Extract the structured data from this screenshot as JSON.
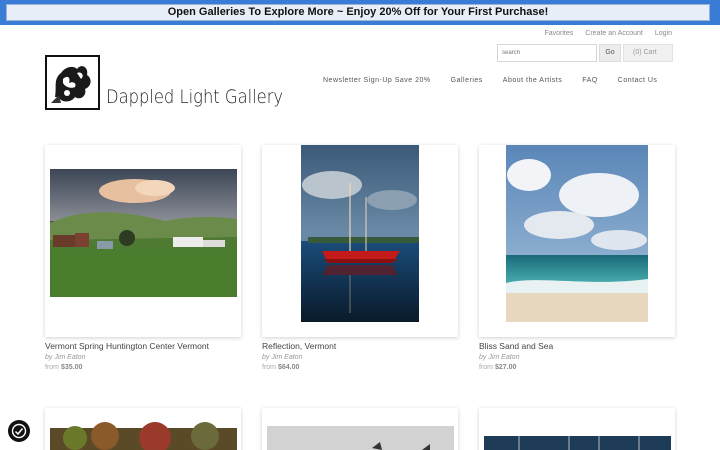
{
  "promo": {
    "text": "Open Galleries To Explore More ~ Enjoy 20% Off for Your First Purchase!"
  },
  "toplinks": {
    "favorites": "Favorites",
    "create_account": "Create an Account",
    "login": "Login"
  },
  "search": {
    "placeholder": "search",
    "go_label": "Go",
    "cart_label": "(0)  Cart"
  },
  "brand": {
    "name": "Dappled Light Gallery"
  },
  "nav": [
    {
      "label": "Newsletter Sign-Up Save 20%"
    },
    {
      "label": "Galleries"
    },
    {
      "label": "About the Artists"
    },
    {
      "label": "FAQ"
    },
    {
      "label": "Contact Us"
    }
  ],
  "products": [
    {
      "title": "Vermont Spring Huntington Center Vermont",
      "artist": "by Jim Eaton",
      "from": "from",
      "price": "$35.00"
    },
    {
      "title": "Reflection, Vermont",
      "artist": "by Jim Eaton",
      "from": "from",
      "price": "$64.00"
    },
    {
      "title": "Bliss Sand and Sea",
      "artist": "by Jim Eaton",
      "from": "from",
      "price": "$27.00"
    }
  ],
  "colors": {
    "promo_bar": "#3a7bd5",
    "promo_box": "#e8eef8"
  }
}
